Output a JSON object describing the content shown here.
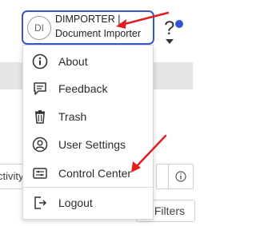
{
  "header": {
    "user": {
      "initials": "DI",
      "name": "DIMPORTER |",
      "role": "Document Importer"
    },
    "help_symbol": "?"
  },
  "menu": {
    "items": [
      {
        "label": "About",
        "icon": "info-icon"
      },
      {
        "label": "Feedback",
        "icon": "feedback-icon"
      },
      {
        "label": "Trash",
        "icon": "trash-icon"
      },
      {
        "label": "User Settings",
        "icon": "user-settings-icon"
      },
      {
        "label": "Control Center",
        "icon": "control-center-icon"
      },
      {
        "label": "Logout",
        "icon": "logout-icon"
      }
    ]
  },
  "background": {
    "activity_fragment": "ctivity",
    "filters_label": "Filters"
  },
  "colors": {
    "accent_border": "#3a57c8",
    "notification_dot": "#2f55d4",
    "annotation_arrow": "#e02020"
  }
}
